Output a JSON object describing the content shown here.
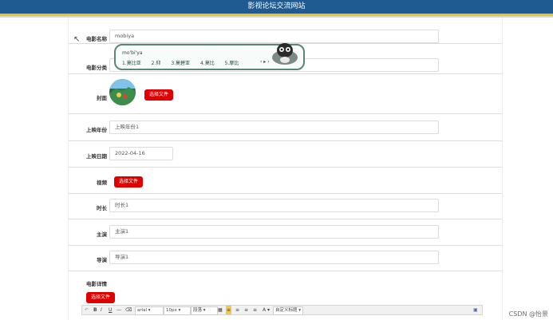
{
  "header": {
    "title": "影视论坛交流网站"
  },
  "form": {
    "movie_name": {
      "label": "电影名称",
      "value": "mobiya"
    },
    "category": {
      "label": "电影分类"
    },
    "cover": {
      "label": "封面",
      "button": "选择文件"
    },
    "release_year": {
      "label": "上映年份",
      "placeholder": "上映年份1"
    },
    "release_date": {
      "label": "上映日期",
      "value": "2022-04-16"
    },
    "video": {
      "label": "视频",
      "button": "选择文件"
    },
    "duration": {
      "label": "时长",
      "value": "时长1"
    },
    "lead_actor": {
      "label": "主演",
      "value": "主演1"
    },
    "director": {
      "label": "导演",
      "value": "导演1"
    },
    "details": {
      "label": "电影详情",
      "button": "选择文件"
    }
  },
  "ime": {
    "pinyin": "mo'bi'ya",
    "candidates": [
      "1.莫比亚",
      "2.仰",
      "3.莫碧亚",
      "4.莫比",
      "5.摩比"
    ],
    "nav": "‹ ▸ ›"
  },
  "editor": {
    "font": "arial",
    "size": "10px",
    "para": "段落",
    "font_color_label": "A",
    "extra": "自定义标题"
  },
  "watermark": "CSDN @怡景"
}
